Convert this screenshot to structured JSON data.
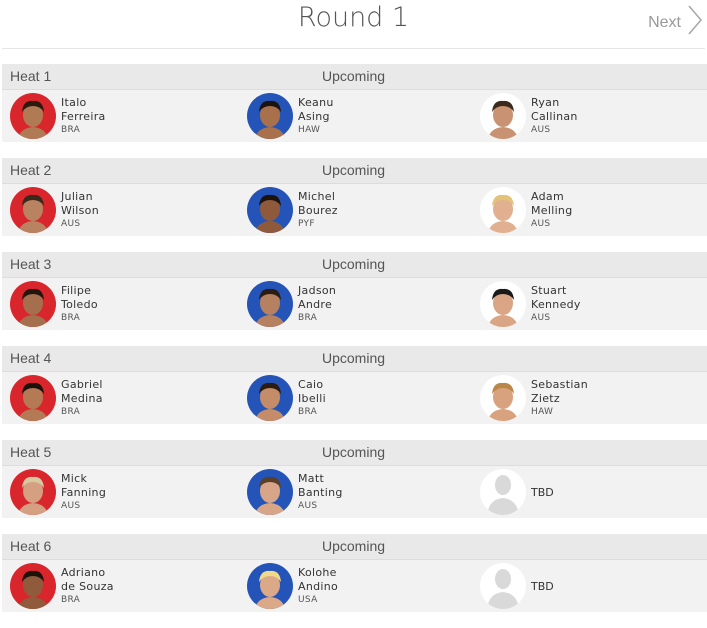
{
  "header": {
    "title": "Round 1",
    "next_label": "Next"
  },
  "colors": {
    "red": "#d9262c",
    "blue": "#2554b8",
    "white": "#ffffff"
  },
  "heats": [
    {
      "name": "Heat 1",
      "status": "Upcoming",
      "surfers": [
        {
          "first": "Italo",
          "last": "Ferreira",
          "country": "BRA",
          "jersey": "red",
          "skin": "#b07a55",
          "hair": "#2a1a10",
          "tbd": false
        },
        {
          "first": "Keanu",
          "last": "Asing",
          "country": "HAW",
          "jersey": "blue",
          "skin": "#a8714c",
          "hair": "#1a1410",
          "tbd": false
        },
        {
          "first": "Ryan",
          "last": "Callinan",
          "country": "AUS",
          "jersey": "white",
          "skin": "#c99272",
          "hair": "#3a2a1c",
          "tbd": false
        }
      ]
    },
    {
      "name": "Heat 2",
      "status": "Upcoming",
      "surfers": [
        {
          "first": "Julian",
          "last": "Wilson",
          "country": "AUS",
          "jersey": "red",
          "skin": "#b98261",
          "hair": "#3b2a1a",
          "tbd": false
        },
        {
          "first": "Michel",
          "last": "Bourez",
          "country": "PYF",
          "jersey": "blue",
          "skin": "#8f5a3c",
          "hair": "#1c130d",
          "tbd": false
        },
        {
          "first": "Adam",
          "last": "Melling",
          "country": "AUS",
          "jersey": "white",
          "skin": "#e0b090",
          "hair": "#e3c27a",
          "tbd": false
        }
      ]
    },
    {
      "name": "Heat 3",
      "status": "Upcoming",
      "surfers": [
        {
          "first": "Filipe",
          "last": "Toledo",
          "country": "BRA",
          "jersey": "red",
          "skin": "#a56e4c",
          "hair": "#22160e",
          "tbd": false
        },
        {
          "first": "Jadson",
          "last": "Andre",
          "country": "BRA",
          "jersey": "blue",
          "skin": "#b58160",
          "hair": "#2b1d12",
          "tbd": false
        },
        {
          "first": "Stuart",
          "last": "Kennedy",
          "country": "AUS",
          "jersey": "white",
          "skin": "#d9a585",
          "hair": "#1a1a1a",
          "tbd": false
        }
      ]
    },
    {
      "name": "Heat 4",
      "status": "Upcoming",
      "surfers": [
        {
          "first": "Gabriel",
          "last": "Medina",
          "country": "BRA",
          "jersey": "red",
          "skin": "#b47955",
          "hair": "#1a120b",
          "tbd": false
        },
        {
          "first": "Caio",
          "last": "Ibelli",
          "country": "BRA",
          "jersey": "blue",
          "skin": "#c48c68",
          "hair": "#2a1c12",
          "tbd": false
        },
        {
          "first": "Sebastian",
          "last": "Zietz",
          "country": "HAW",
          "jersey": "white",
          "skin": "#d8a27e",
          "hair": "#b98848",
          "tbd": false
        }
      ]
    },
    {
      "name": "Heat 5",
      "status": "Upcoming",
      "surfers": [
        {
          "first": "Mick",
          "last": "Fanning",
          "country": "AUS",
          "jersey": "red",
          "skin": "#d59f82",
          "hair": "#d8c8a0",
          "tbd": false
        },
        {
          "first": "Matt",
          "last": "Banting",
          "country": "AUS",
          "jersey": "blue",
          "skin": "#d7a587",
          "hair": "#5a4028",
          "tbd": false
        },
        {
          "first": "",
          "last": "TBD",
          "country": "",
          "jersey": "placeholder",
          "skin": "#e0e0e0",
          "hair": "#e0e0e0",
          "tbd": true
        }
      ]
    },
    {
      "name": "Heat 6",
      "status": "Upcoming",
      "surfers": [
        {
          "first": "Adriano",
          "last": "de Souza",
          "country": "BRA",
          "jersey": "red",
          "skin": "#8f5b3c",
          "hair": "#1a120b",
          "tbd": false
        },
        {
          "first": "Kolohe",
          "last": "Andino",
          "country": "USA",
          "jersey": "blue",
          "skin": "#dba987",
          "hair": "#f0d98a",
          "tbd": false
        },
        {
          "first": "",
          "last": "TBD",
          "country": "",
          "jersey": "placeholder",
          "skin": "#e0e0e0",
          "hair": "#e0e0e0",
          "tbd": true
        }
      ]
    }
  ]
}
